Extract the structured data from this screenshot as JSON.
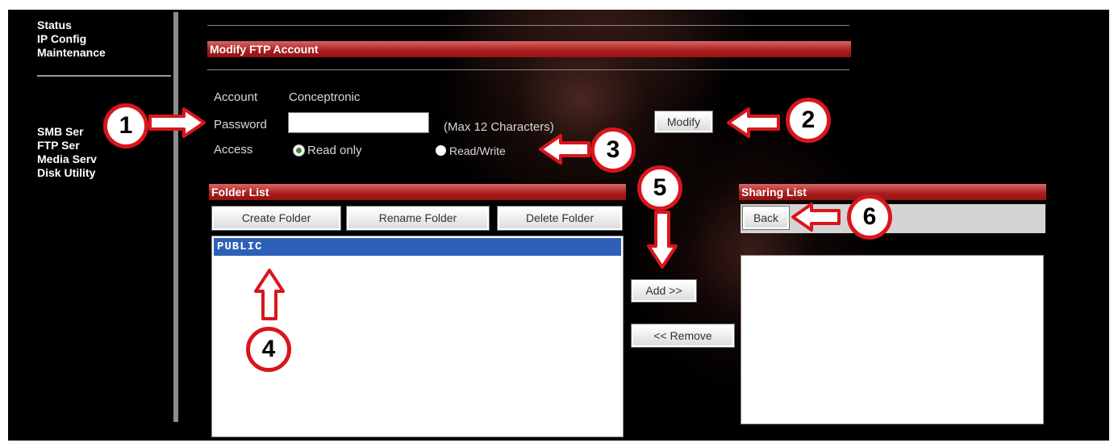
{
  "sidebar": {
    "items": [
      {
        "label": "Status"
      },
      {
        "label": "IP Config"
      },
      {
        "label": "Maintenance"
      },
      {
        "label": "SMB Ser"
      },
      {
        "label": "FTP Ser"
      },
      {
        "label": "Media Serv"
      },
      {
        "label": "Disk Utility"
      }
    ]
  },
  "modify_section": {
    "title": "Modify FTP Account",
    "account_label": "Account",
    "account_value": "Conceptronic",
    "password_label": "Password",
    "password_value": "",
    "password_hint": "(Max 12 Characters)",
    "access_label": "Access",
    "access_options": [
      {
        "label": "Read only",
        "selected": true
      },
      {
        "label": "Read/Write",
        "selected": false
      }
    ],
    "modify_button": "Modify"
  },
  "folder_list": {
    "title": "Folder List",
    "buttons": {
      "create": "Create Folder",
      "rename": "Rename Folder",
      "delete": "Delete Folder"
    },
    "items": [
      {
        "name": "PUBLIC",
        "selected": true
      }
    ]
  },
  "transfer_buttons": {
    "add": "Add >>",
    "remove": "<< Remove"
  },
  "sharing_list": {
    "title": "Sharing List",
    "back_button": "Back",
    "items": []
  },
  "annotations": {
    "numbers": [
      "1",
      "2",
      "3",
      "4",
      "5",
      "6"
    ],
    "color": "#d8161c"
  },
  "colors": {
    "titlebar": "#a81c1c",
    "selection": "#2f60b8",
    "background": "#000000"
  }
}
